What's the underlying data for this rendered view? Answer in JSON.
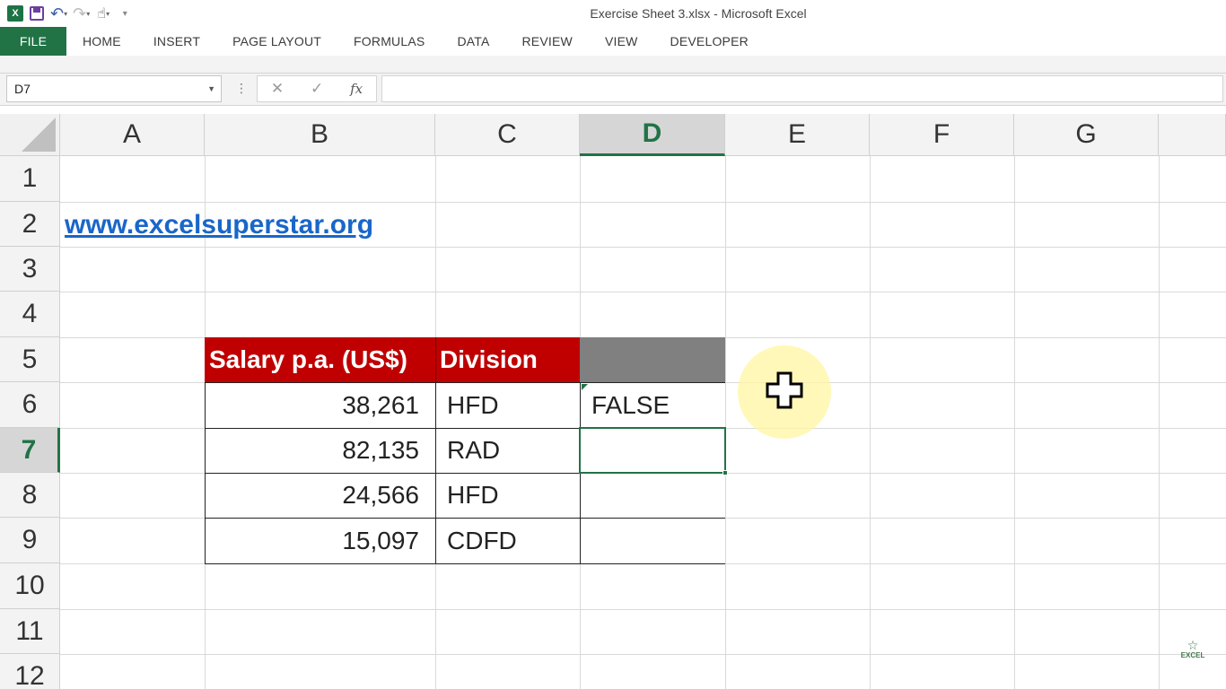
{
  "window": {
    "title": "Exercise Sheet 3.xlsx - Microsoft Excel"
  },
  "qat": {
    "app_icon": "excel-logo",
    "save_icon": "save-icon",
    "undo_icon": "undo-icon",
    "redo_icon": "redo-icon",
    "touch_icon": "touch-mode-icon",
    "customize_icon": "customize-qat-icon"
  },
  "ribbon": {
    "tabs": [
      "FILE",
      "HOME",
      "INSERT",
      "PAGE LAYOUT",
      "FORMULAS",
      "DATA",
      "REVIEW",
      "VIEW",
      "DEVELOPER"
    ]
  },
  "formula_bar": {
    "name_box": "D7",
    "formula": "",
    "cancel_icon": "cancel-x-icon",
    "enter_icon": "checkmark-icon",
    "fx_label": "fx"
  },
  "sheet": {
    "columns": [
      "A",
      "B",
      "C",
      "D",
      "E",
      "F",
      "G"
    ],
    "selected_column": "D",
    "rows": [
      "1",
      "2",
      "3",
      "4",
      "5",
      "6",
      "7",
      "8",
      "9",
      "10",
      "11",
      "12"
    ],
    "selected_row": "7",
    "link": "www.excelsuperstar.org",
    "table": {
      "headers": [
        "Salary p.a. (US$)",
        "Division",
        ""
      ],
      "rows": [
        {
          "salary": "38,261",
          "division": "HFD",
          "result": "FALSE"
        },
        {
          "salary": "82,135",
          "division": "RAD",
          "result": ""
        },
        {
          "salary": "24,566",
          "division": "HFD",
          "result": ""
        },
        {
          "salary": "15,097",
          "division": "CDFD",
          "result": ""
        }
      ],
      "header_color": "#c00000",
      "header_gray": "#808080"
    }
  },
  "watermark": {
    "text": "EXCEL",
    "icon": "star-icon"
  },
  "colors": {
    "excel_green": "#217346",
    "link_blue": "#1a66c9"
  }
}
